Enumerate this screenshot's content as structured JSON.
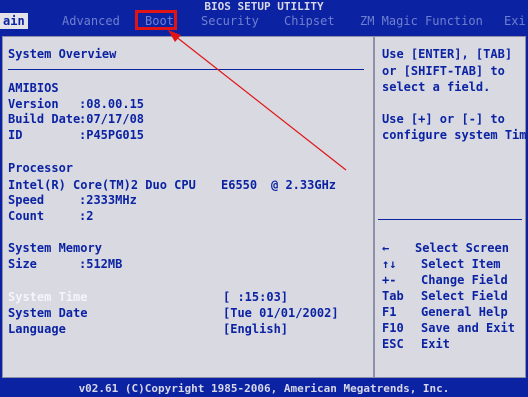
{
  "window": {
    "title": "BIOS SETUP UTILITY",
    "footer": "v02.61 (C)Copyright 1985-2006, American Megatrends, Inc."
  },
  "tabs": [
    {
      "label": "Main",
      "visible_label": "ain"
    },
    {
      "label": "Advanced"
    },
    {
      "label": "Boot"
    },
    {
      "label": "Security"
    },
    {
      "label": "Chipset"
    },
    {
      "label": "ZM Magic Function"
    },
    {
      "label": "Exi"
    }
  ],
  "overview": {
    "heading": "System Overview",
    "amibios": {
      "heading": "AMIBIOS",
      "version_label": "Version",
      "version_value": ":08.00.15",
      "build_label": "Build Date",
      "build_value": ":07/17/08",
      "id_label": "ID",
      "id_value": ":P45PG015"
    },
    "processor": {
      "heading": "Processor",
      "name": "Intel(R) Core(TM)2 Duo CPU",
      "model": "E6550",
      "freq": "@ 2.33GHz",
      "speed_label": "Speed",
      "speed_value": ":2333MHz",
      "count_label": "Count",
      "count_value": ":2"
    },
    "memory": {
      "heading": "System Memory",
      "size_label": "Size",
      "size_value": ":512MB"
    },
    "time_label": "System Time",
    "time_value": "[  :15:03]",
    "date_label": "System Date",
    "date_value": "[Tue 01/01/2002]",
    "language_label": "Language",
    "language_value": "[English]"
  },
  "help": {
    "line1": "Use [ENTER], [TAB]",
    "line2": "or [SHIFT-TAB] to",
    "line3": "select a field.",
    "line4": "Use [+] or [-] to",
    "line5": "configure system Time"
  },
  "keys": [
    {
      "key": "←",
      "action": "Select Screen"
    },
    {
      "key": "↑↓",
      "action": "Select Item"
    },
    {
      "key": "+-",
      "action": "Change Field"
    },
    {
      "key": "Tab",
      "action": "Select Field"
    },
    {
      "key": "F1",
      "action": "General Help"
    },
    {
      "key": "F10",
      "action": "Save and Exit"
    },
    {
      "key": "ESC",
      "action": "Exit"
    }
  ],
  "colors": {
    "background": "#0b23a3",
    "panel": "#d9d9e1",
    "annotation": "#e01414"
  }
}
